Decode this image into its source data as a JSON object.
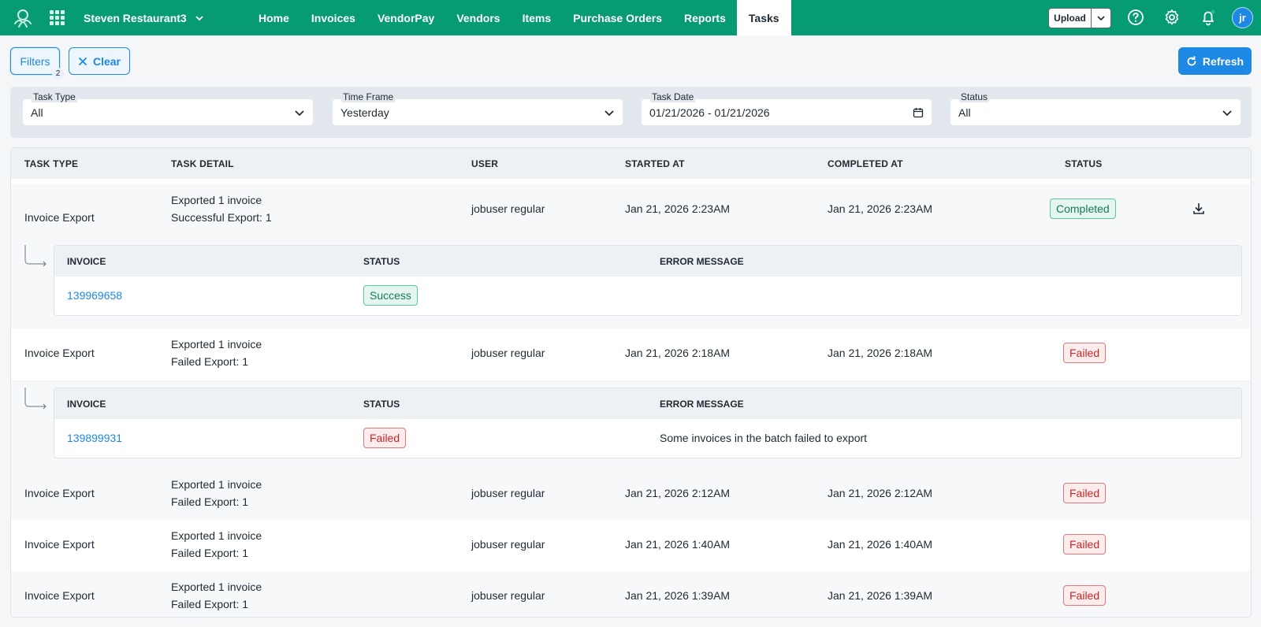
{
  "topnav": {
    "org_name": "Steven Restaurant3",
    "items": [
      {
        "label": "Home"
      },
      {
        "label": "Invoices"
      },
      {
        "label": "VendorPay"
      },
      {
        "label": "Vendors"
      },
      {
        "label": "Items"
      },
      {
        "label": "Purchase Orders"
      },
      {
        "label": "Reports"
      },
      {
        "label": "Tasks",
        "active": true
      }
    ],
    "upload_label": "Upload",
    "avatar_initials": "jr",
    "brand_color": "#079b74"
  },
  "actions": {
    "filters_label": "Filters",
    "filters_count": "2",
    "clear_label": "Clear",
    "refresh_label": "Refresh",
    "accent_color": "#1e88e5"
  },
  "filters": [
    {
      "label": "Task Type",
      "value": "All"
    },
    {
      "label": "Time Frame",
      "value": "Yesterday"
    },
    {
      "label": "Task Date",
      "value": "01/21/2026 - 01/21/2026"
    },
    {
      "label": "Status",
      "value": "All"
    }
  ],
  "table": {
    "columns": [
      "TASK TYPE",
      "TASK DETAIL",
      "USER",
      "STARTED AT",
      "COMPLETED AT",
      "STATUS"
    ],
    "rows": [
      {
        "type": "Invoice Export",
        "detail1": "Exported 1 invoice",
        "detail2": "Successful Export: 1",
        "user": "jobuser regular",
        "started": "Jan 21, 2026 2:23AM",
        "completed": "Jan 21, 2026 2:23AM",
        "status": "Completed"
      },
      {
        "type": "Invoice Export",
        "detail1": "Exported 1 invoice",
        "detail2": "Failed Export: 1",
        "user": "jobuser regular",
        "started": "Jan 21, 2026 2:18AM",
        "completed": "Jan 21, 2026 2:18AM",
        "status": "Failed"
      },
      {
        "type": "Invoice Export",
        "detail1": "Exported 1 invoice",
        "detail2": "Failed Export: 1",
        "user": "jobuser regular",
        "started": "Jan 21, 2026 2:12AM",
        "completed": "Jan 21, 2026 2:12AM",
        "status": "Failed"
      },
      {
        "type": "Invoice Export",
        "detail1": "Exported 1 invoice",
        "detail2": "Failed Export: 1",
        "user": "jobuser regular",
        "started": "Jan 21, 2026 1:40AM",
        "completed": "Jan 21, 2026 1:40AM",
        "status": "Failed"
      },
      {
        "type": "Invoice Export",
        "detail1": "Exported 1 invoice",
        "detail2": "Failed Export: 1",
        "user": "jobuser regular",
        "started": "Jan 21, 2026 1:39AM",
        "completed": "Jan 21, 2026 1:39AM",
        "status": "Failed"
      }
    ]
  },
  "subtables": {
    "columns": [
      "INVOICE",
      "STATUS",
      "ERROR MESSAGE"
    ],
    "items": [
      {
        "invoice": "139969658",
        "status": "Success",
        "error": ""
      },
      {
        "invoice": "139899931",
        "status": "Failed",
        "error": "Some invoices in the batch failed to export"
      }
    ]
  }
}
